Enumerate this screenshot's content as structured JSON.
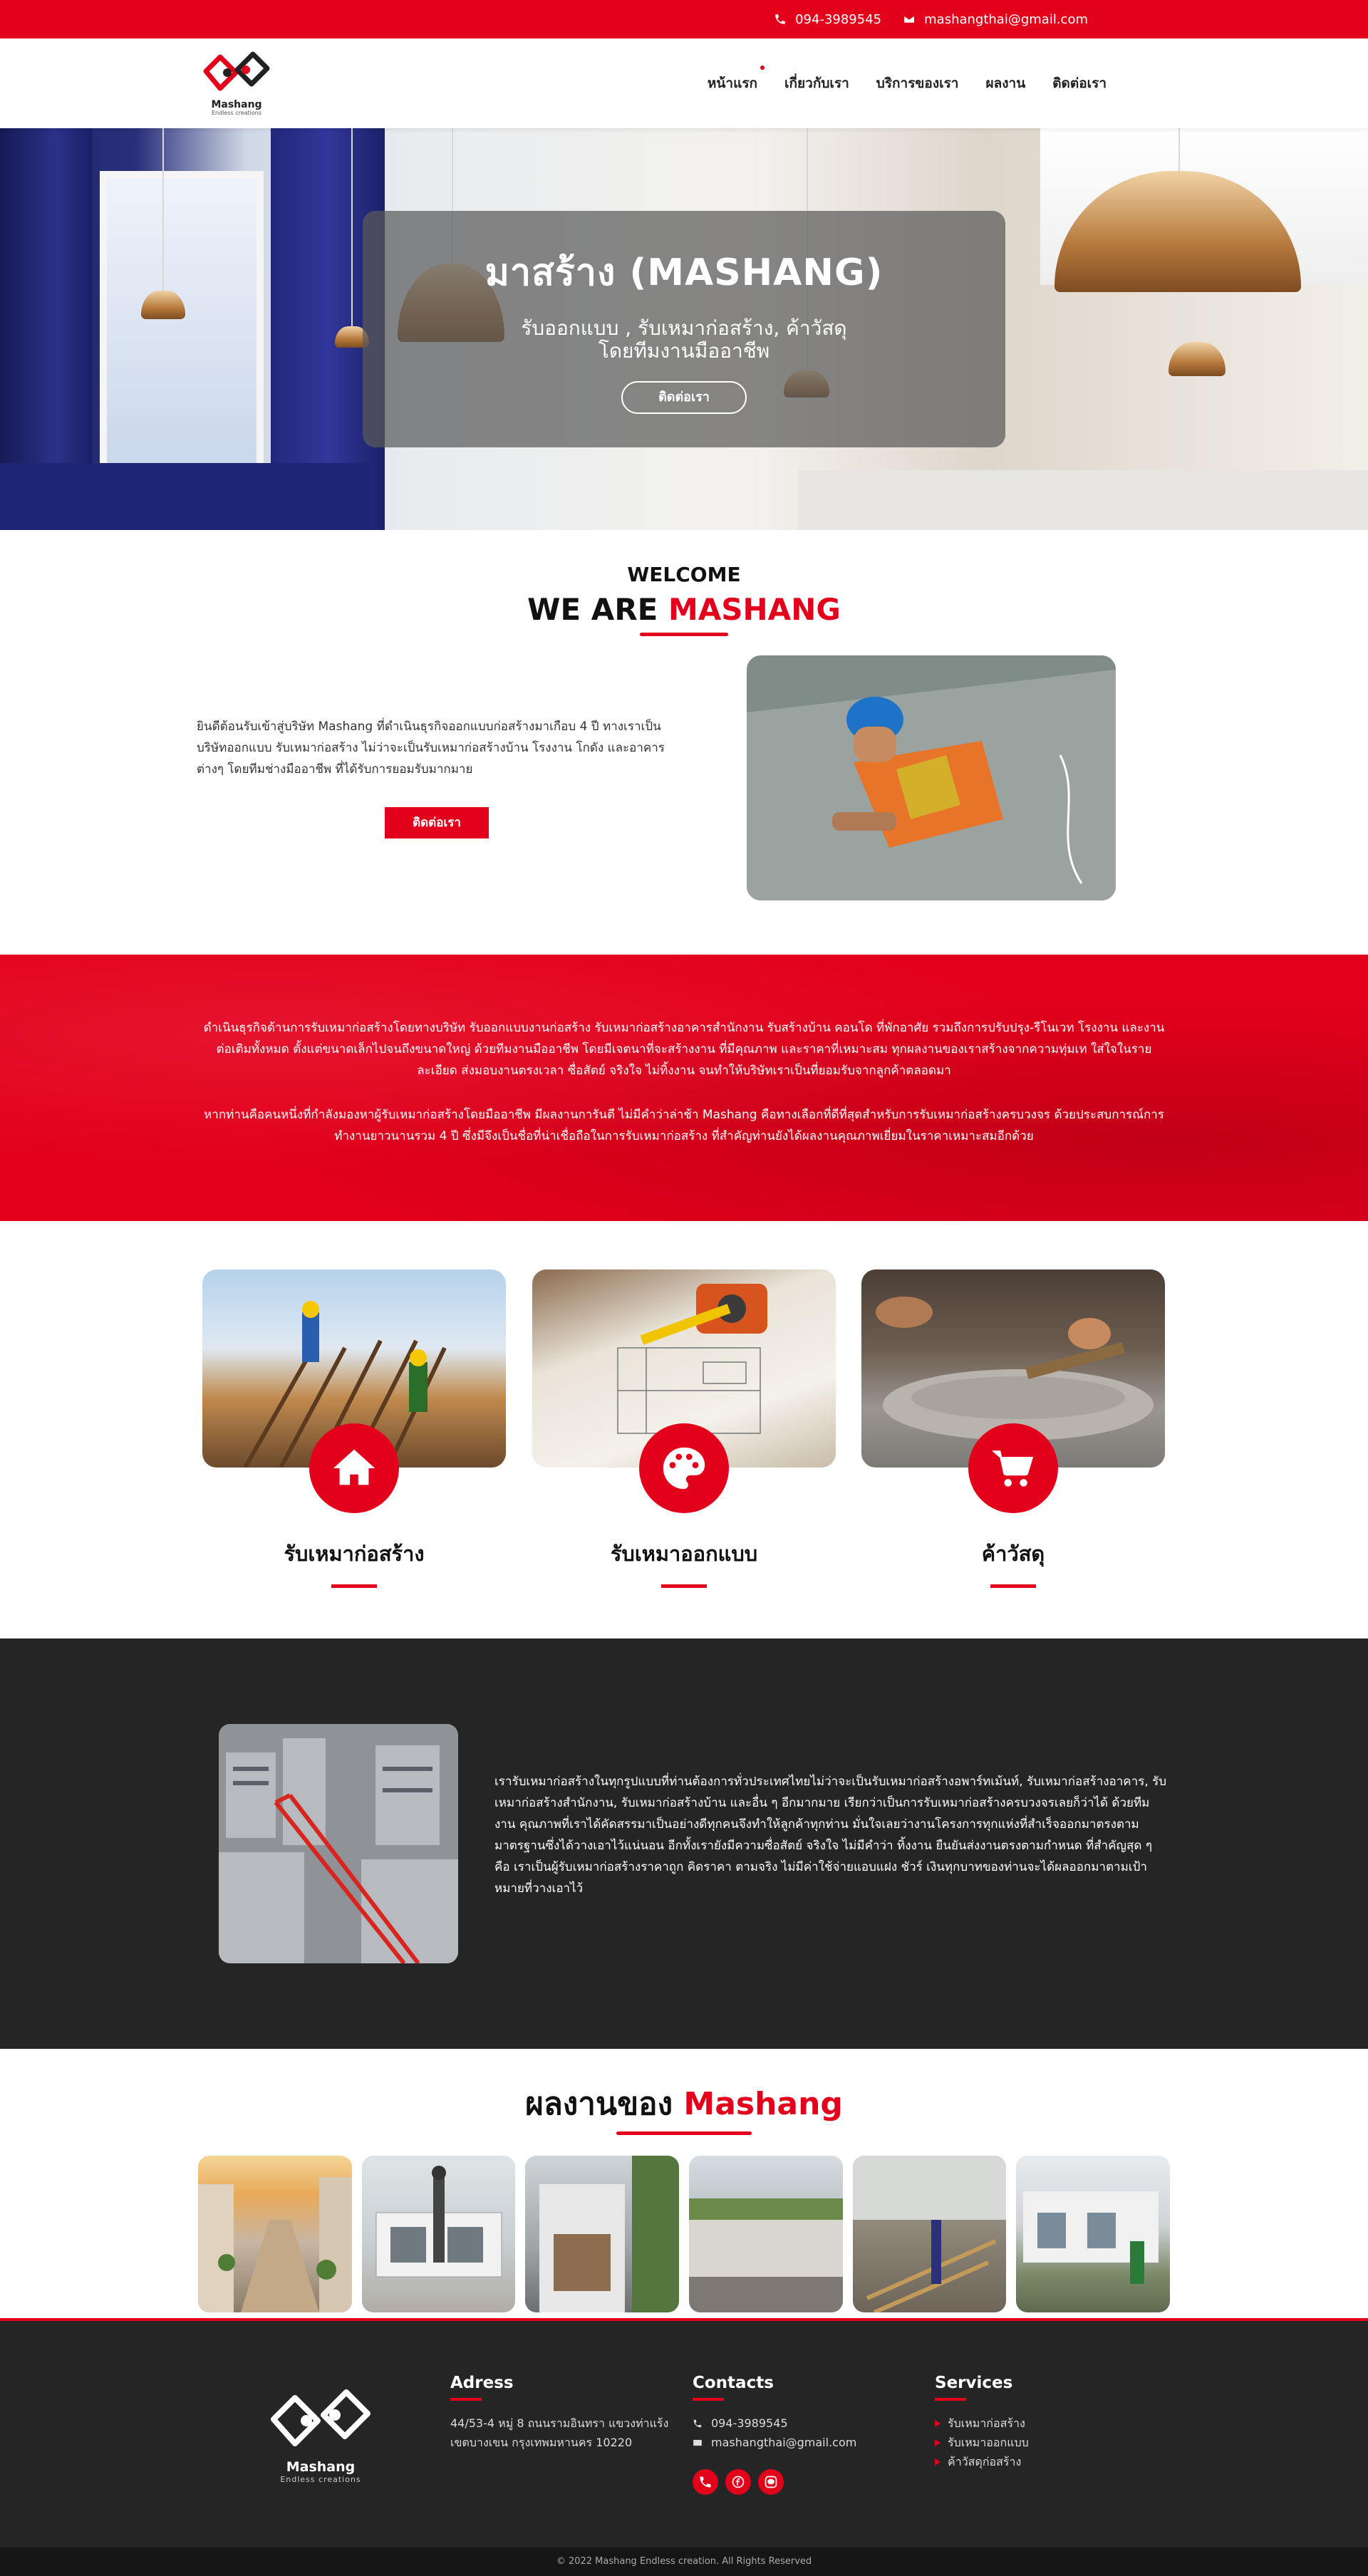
{
  "topbar": {
    "phone": "094-3989545",
    "email": "mashangthai@gmail.com"
  },
  "brand": {
    "name": "Mashang",
    "tagline": "Endless creations"
  },
  "nav": [
    "หน้าแรก",
    "เกี่ยวกับเรา",
    "บริการของเรา",
    "ผลงาน",
    "ติดต่อเรา"
  ],
  "hero": {
    "title": "มาสร้าง (MASHANG)",
    "line1": "รับออกแบบ , รับเหมาก่อสร้าง, ค้าวัสดุ",
    "line2": "โดยทีมงานมืออาชีพ",
    "button": "ติดต่อเรา"
  },
  "welcome": {
    "small": "WELCOME",
    "big_prefix": "WE ARE",
    "big_highlight": "MASHANG",
    "text": "ยินดีต้อนรับเข้าสู่บริษัท Mashang ที่ดำเนินธุรกิจออกแบบก่อสร้างมาเกือบ 4 ปี ทางเราเป็นบริษัทออกแบบ รับเหมาก่อสร้าง ไม่ว่าจะเป็นรับเหมาก่อสร้างบ้าน โรงงาน โกดัง และอาคารต่างๆ โดยทีมช่างมืออาชีพ ที่ได้รับการยอมรับมากมาย",
    "button": "ติดต่อเรา"
  },
  "banner": {
    "p1": "ดำเนินธุรกิจด้านการรับเหมาก่อสร้างโดยทางบริษัท รับออกแบบงานก่อสร้าง รับเหมาก่อสร้างอาคารสำนักงาน รับสร้างบ้าน คอนโด ที่พักอาศัย รวมถึงการปรับปรุง-รีโนเวท โรงงาน และงานต่อเติมทั้งหมด ตั้งแต่ขนาดเล็กไปจนถึงขนาดใหญ่ ด้วยทีมงานมืออาชีพ โดยมีเจตนาที่จะสร้างงาน ที่มีคุณภาพ และราคาที่เหมาะสม ทุกผลงานของเราสร้างจากความทุ่มเท ใส่ใจในรายละเอียด ส่งมอบงานตรงเวลา ซื่อสัตย์ จริงใจ ไม่ทิ้งงาน จนทำให้บริษัทเราเป็นที่ยอมรับจากลูกค้าตลอดมา",
    "p2": "หากท่านคือคนหนึ่งที่กำลังมองหาผู้รับเหมาก่อสร้างโดยมืออาชีพ มีผลงานการันตี ไม่มีคำว่าล่าช้า Mashang คือทางเลือกที่ดีที่สุดสำหรับการรับเหมาก่อสร้างครบวงจร ด้วยประสบการณ์การทำงานยาวนานรวม 4 ปี ซึ่งมีจึงเป็นชื่อที่น่าเชื่อถือในการรับเหมาก่อสร้าง ที่สำคัญท่านยังได้ผลงานคุณภาพเยี่ยมในราคาเหมาะสมอีกด้วย"
  },
  "services": [
    {
      "title": "รับเหมาก่อสร้าง",
      "icon": "home-icon"
    },
    {
      "title": "รับเหมาออกแบบ",
      "icon": "palette-icon"
    },
    {
      "title": "ค้าวัสดุ",
      "icon": "cart-icon"
    }
  ],
  "about": {
    "text": "เรารับเหมาก่อสร้างในทุกรูปแบบที่ท่านต้องการทั่วประเทศไทยไม่ว่าจะเป็นรับเหมาก่อสร้างอพาร์ทเม้นท์, รับเหมาก่อสร้างอาคาร, รับเหมาก่อสร้างสำนักงาน, รับเหมาก่อสร้างบ้าน และอื่น ๆ อีกมากมาย เรียกว่าเป็นการรับเหมาก่อสร้างครบวงจรเลยก็ว่าได้ ด้วยทีมงาน คุณภาพที่เราได้คัดสรรมาเป็นอย่างดีทุกคนจึงทำให้ลูกค้าทุกท่าน มั่นใจเลยว่างานโครงการทุกแห่งที่สำเร็จออกมาตรงตามมาตรฐานซึ่งได้วางเอาไว้แน่นอน อีกทั้งเรายังมีความซื่อสัตย์ จริงใจ ไม่มีคำว่า ทิ้งงาน ยืนยันส่งงานตรงตามกำหนด ที่สำคัญสุด ๆ คือ เราเป็นผู้รับเหมาก่อสร้างราคาถูก คิดราคา ตามจริง ไม่มีค่าใช้จ่ายแอบแฝง ชัวร์ เงินทุกบาทของท่านจะได้ผลออกมาตามเป้าหมายที่วางเอาไว้"
  },
  "portfolio": {
    "title_prefix": "ผลงานของ",
    "title_highlight": "Mashang"
  },
  "footer": {
    "address_title": "Adress",
    "address": "44/53-4 หมู่ 8 ถนนรามอินทรา แขวงท่าแร้ง เขตบางเขน กรุงเทพมหานคร 10220",
    "contacts_title": "Contacts",
    "phone": "094-3989545",
    "email": "mashangthai@gmail.com",
    "services_title": "Services",
    "services": [
      "รับเหมาก่อสร้าง",
      "รับเหมาออกแบบ",
      "ค้าวัสดุก่อสร้าง"
    ],
    "copyright": "© 2022 Mashang Endless creation. All Rights Reserved"
  },
  "colors": {
    "accent": "#e3001b",
    "dark": "#252525"
  }
}
